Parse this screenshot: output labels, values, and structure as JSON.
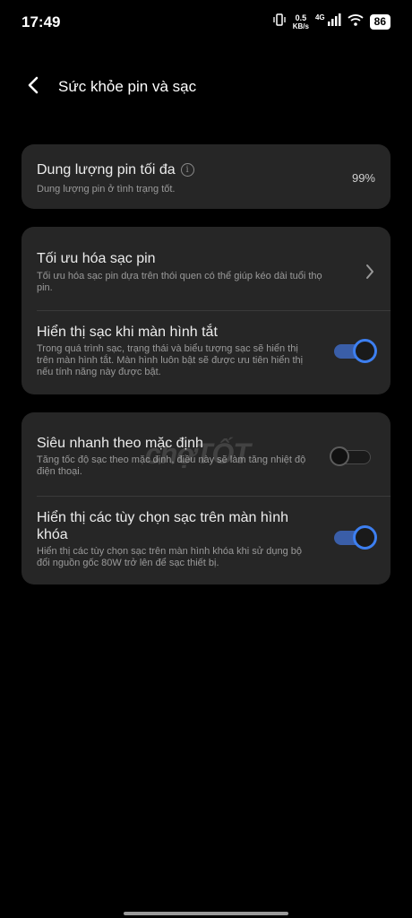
{
  "status_bar": {
    "time": "17:49",
    "net_speed_value": "0.5",
    "net_speed_unit": "KB/s",
    "network_type": "4G",
    "battery": "86",
    "icons": [
      "vibrate-icon",
      "signal-icon",
      "wifi-icon",
      "battery-icon"
    ]
  },
  "header": {
    "title": "Sức khỏe pin và sạc",
    "back_icon": "back-arrow-icon"
  },
  "battery_capacity": {
    "title": "Dung lượng pin tối đa",
    "description": "Dung lượng pin ở tình trạng tốt.",
    "value": "99%"
  },
  "charging_section": {
    "optimize": {
      "title": "Tối ưu hóa sạc pin",
      "description_line1": "Tối ưu hóa sạc pin dựa trên thói quen có thể giúp kéo dài tuổi thọ",
      "description_line2": "pin."
    },
    "screen_off": {
      "title": "Hiển thị sạc khi màn hình tắt",
      "description_line1": "Trong quá trình sạc, trạng thái và biểu tượng sạc sẽ hiển thị",
      "description_line2": "trên màn hình tắt. Màn hình luôn bật sẽ được ưu tiên hiển thị",
      "description_line3": "nếu tính năng này được bật.",
      "enabled": true
    }
  },
  "fast_section": {
    "super_fast": {
      "title": "Siêu nhanh theo mặc định",
      "description_line1": "Tăng tốc độ sạc theo mặc định, điều này sẽ làm tăng nhiệt độ",
      "description_line2": "điện thoại.",
      "enabled": false
    },
    "lockscreen_options": {
      "title_line1": "Hiển thị các tùy chọn sạc trên màn hình",
      "title_line2": "khóa",
      "description_line1": "Hiển thị các tùy chọn sạc trên màn hình khóa khi sử dụng bộ",
      "description_line2": "đổi nguồn gốc 80W trở lên để sạc thiết bị.",
      "enabled": true
    }
  },
  "watermark": "chợTỐT",
  "colors": {
    "background": "#000000",
    "card": "#262626",
    "accent": "#3d7ff0",
    "secondary_text": "#9a9a9a"
  }
}
